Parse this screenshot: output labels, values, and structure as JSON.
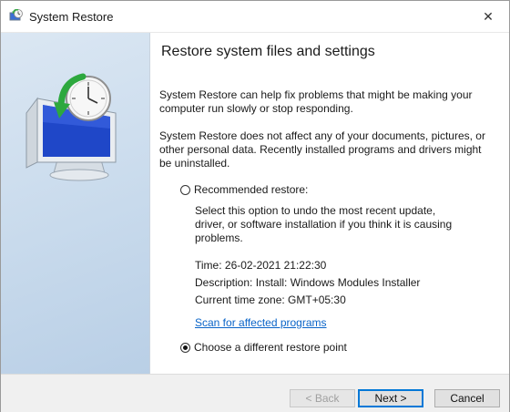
{
  "window": {
    "title": "System Restore",
    "close_glyph": "✕"
  },
  "content": {
    "heading": "Restore system files and settings",
    "paragraph1": "System Restore can help fix problems that might be making your computer run slowly or stop responding.",
    "paragraph2": "System Restore does not affect any of your documents, pictures, or other personal data. Recently installed programs and drivers might be uninstalled.",
    "recommended": {
      "label": "Recommended restore:",
      "checked": false,
      "description": "Select this option to undo the most recent update, driver, or software installation if you think it is causing problems.",
      "time": "Time: 26-02-2021 21:22:30",
      "description_line": "Description: Install: Windows Modules Installer",
      "timezone": "Current time zone: GMT+05:30"
    },
    "scan_link": "Scan for affected programs",
    "different": {
      "label": "Choose a different restore point",
      "checked": true
    }
  },
  "footer": {
    "back_label": "< Back",
    "next_label": "Next >",
    "cancel_label": "Cancel"
  },
  "icons": {
    "title": "system-restore-icon",
    "side": "restore-clock-computer-icon"
  },
  "colors": {
    "link": "#0a64c8",
    "focus": "#0078d7",
    "side_panel": "#c8daec"
  }
}
